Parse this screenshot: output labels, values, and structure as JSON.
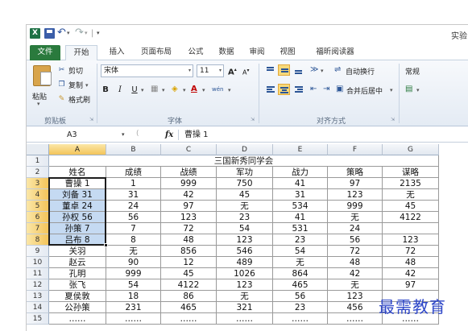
{
  "quick_access": {
    "app_icon": "excel-icon",
    "undo_icon": "undo-icon",
    "redo_icon": "redo-icon"
  },
  "title_text": "实验",
  "tabs": [
    {
      "id": "file",
      "label": "文件"
    },
    {
      "id": "home",
      "label": "开始"
    },
    {
      "id": "insert",
      "label": "插入"
    },
    {
      "id": "layout",
      "label": "页面布局"
    },
    {
      "id": "formulas",
      "label": "公式"
    },
    {
      "id": "data",
      "label": "数据"
    },
    {
      "id": "review",
      "label": "审阅"
    },
    {
      "id": "view",
      "label": "视图"
    },
    {
      "id": "foxit",
      "label": "福昕阅读器"
    }
  ],
  "ribbon": {
    "clipboard": {
      "paste": "粘贴",
      "cut": "剪切",
      "copy": "复制",
      "format_painter": "格式刷",
      "group": "剪贴板"
    },
    "font": {
      "name": "宋体",
      "size": "11",
      "group": "字体",
      "grow": "A",
      "shrink": "A",
      "bold": "B",
      "italic": "I",
      "underline": "U",
      "font_color": "A",
      "phonetic": "wén"
    },
    "alignment": {
      "wrap": "自动换行",
      "merge": "合并后居中",
      "group": "对齐方式"
    },
    "number": {
      "format": "常规"
    }
  },
  "formula_bar": {
    "cell_ref": "A3",
    "fx": "fx",
    "content": "曹操   1"
  },
  "sheet": {
    "columns": [
      "A",
      "B",
      "C",
      "D",
      "E",
      "F",
      "G"
    ],
    "title": "三国新秀同学会",
    "headers": [
      "姓名",
      "成绩",
      "战绩",
      "军功",
      "战力",
      "策略",
      "谋略"
    ],
    "rows": [
      [
        "曹操   1",
        "1",
        "999",
        "750",
        "41",
        "97",
        "2135"
      ],
      [
        "刘备   31",
        "31",
        "42",
        "45",
        "31",
        "123",
        "无"
      ],
      [
        "董卓   24",
        "24",
        "97",
        "无",
        "534",
        "999",
        "45"
      ],
      [
        "孙权   56",
        "56",
        "123",
        "23",
        "41",
        "无",
        "4122"
      ],
      [
        "孙策   7",
        "7",
        "72",
        "54",
        "531",
        "24",
        ""
      ],
      [
        "吕布   8",
        "8",
        "48",
        "123",
        "23",
        "56",
        "123"
      ],
      [
        "关羽",
        "无",
        "856",
        "546",
        "54",
        "72",
        "72"
      ],
      [
        "赵云",
        "90",
        "12",
        "489",
        "无",
        "48",
        "48"
      ],
      [
        "孔明",
        "999",
        "45",
        "1026",
        "864",
        "42",
        "42"
      ],
      [
        "张飞",
        "54",
        "4122",
        "123",
        "465",
        "无",
        "97"
      ],
      [
        "夏侯敦",
        "18",
        "86",
        "无",
        "56",
        "123",
        ""
      ],
      [
        "公孙策",
        "231",
        "465",
        "321",
        "23",
        "456",
        ""
      ],
      [
        "……",
        "……",
        "……",
        "……",
        "……",
        "……",
        "……"
      ]
    ],
    "row_numbers": [
      "1",
      "2",
      "3",
      "4",
      "5",
      "6",
      "7",
      "8",
      "9",
      "10",
      "11",
      "12",
      "13",
      "14",
      "15"
    ]
  },
  "watermark": "最需教育",
  "colors": {
    "file_tab": "#2a7a3d",
    "selection": "#c5daf2",
    "header_selected": "#f3c45a",
    "watermark": "#2d46c8"
  }
}
